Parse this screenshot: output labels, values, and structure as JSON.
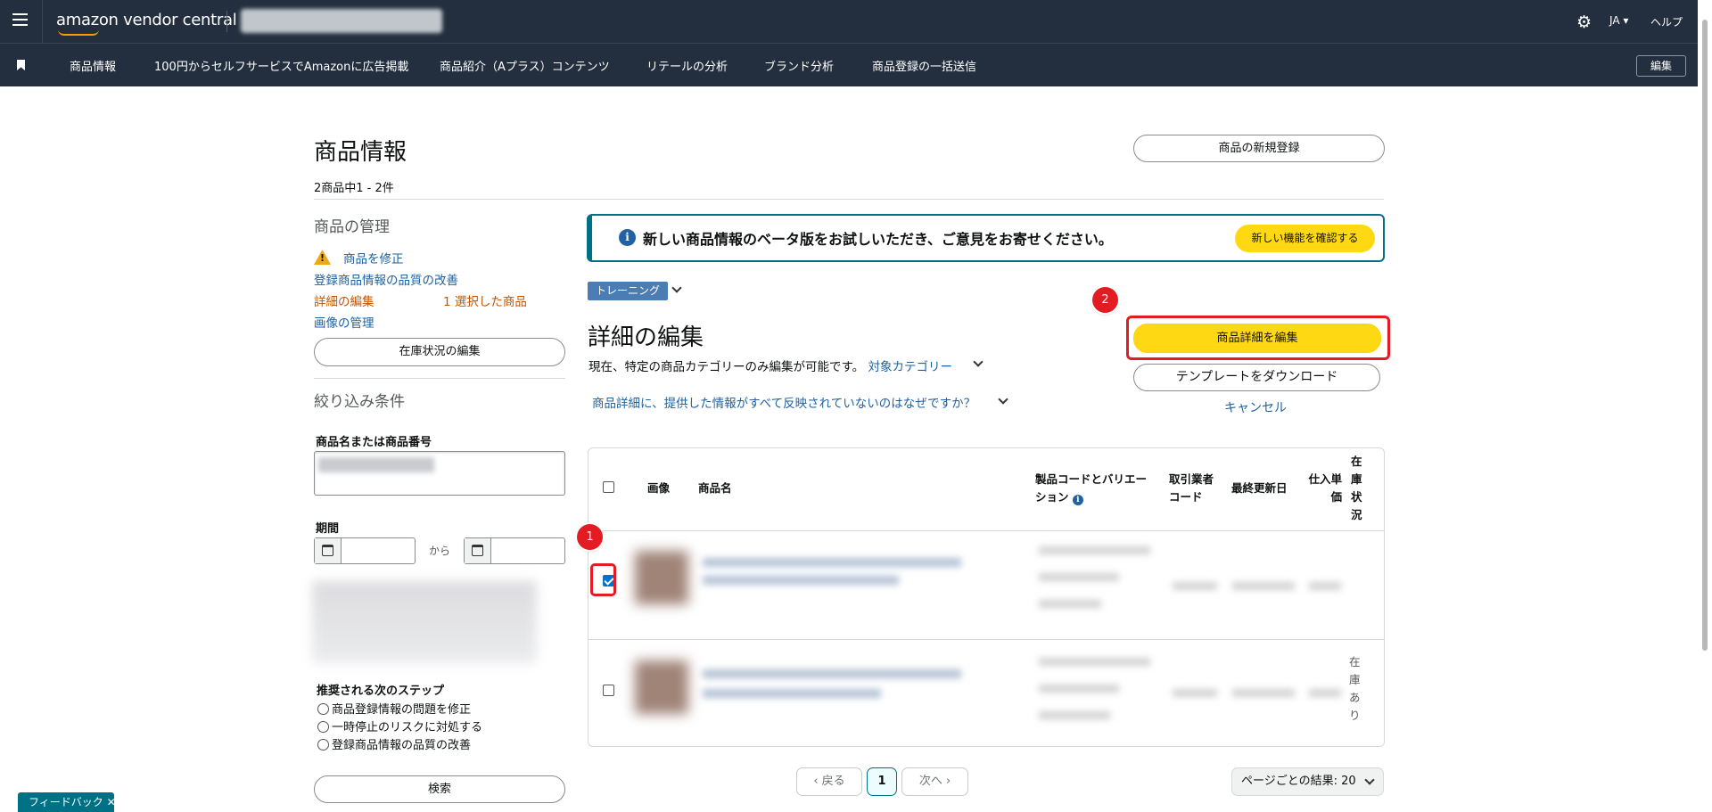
{
  "topbar": {
    "logo": "amazon vendor central",
    "lang": "JA ▾",
    "help": "ヘルプ"
  },
  "nav": {
    "items": [
      "商品情報",
      "100円からセルフサービスでAmazonに広告掲載",
      "商品紹介（Aプラス）コンテンツ",
      "リテールの分析",
      "ブランド分析",
      "商品登録の一括送信"
    ],
    "edit": "編集"
  },
  "page": {
    "title": "商品情報",
    "count": "2商品中1 - 2件",
    "new_button": "商品の新規登録"
  },
  "sidebar": {
    "manage_heading": "商品の管理",
    "fix_link": "商品を修正",
    "quality_link": "登録商品情報の品質の改善",
    "edit_details": "詳細の編集",
    "selected": "1 選択した商品",
    "images_link": "画像の管理",
    "inventory_button": "在庫状況の編集",
    "filter_heading": "絞り込み条件",
    "name_label": "商品名または商品番号",
    "period_label": "期間",
    "from": "から",
    "steps_title": "推奨される次のステップ",
    "steps": [
      "商品登録情報の問題を修正",
      "一時停止のリスクに対処する",
      "登録商品情報の品質の改善"
    ],
    "search_button": "検索"
  },
  "beta": {
    "text": "新しい商品情報のベータ版をお試しいただき、ご意見をお寄せください。",
    "button": "新しい機能を確認する"
  },
  "edit": {
    "training": "トレーニング",
    "heading": "詳細の編集",
    "desc": "現在、特定の商品カテゴリーのみ編集が可能です。",
    "category_link": "対象カテゴリー",
    "why_link": "商品詳細に、提供した情報がすべて反映されていないのはなぜですか？",
    "edit_button": "商品詳細を編集",
    "template_button": "テンプレートをダウンロード",
    "cancel": "キャンセル",
    "badge1": "1",
    "badge2": "2"
  },
  "table": {
    "headers": {
      "image": "画像",
      "name": "商品名",
      "code": "製品コードとバリエーション",
      "vendor": "取引業者コード",
      "updated": "最終更新日",
      "cost": "仕入単価",
      "stock": "在庫状況"
    },
    "rows": [
      {
        "checked": true,
        "stock": ""
      },
      {
        "checked": false,
        "stock": "在庫あり"
      }
    ]
  },
  "pagination": {
    "prev": "‹ 戻る",
    "current": "1",
    "next": "次へ ›",
    "per_page": "ページごとの結果: 20"
  },
  "feedback": "フィードバック ✕"
}
